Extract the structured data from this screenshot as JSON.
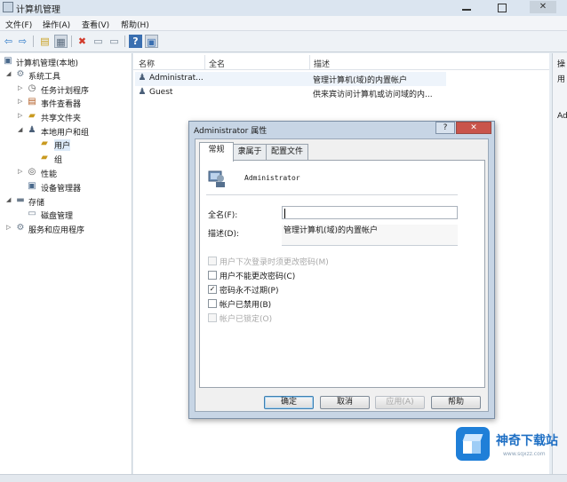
{
  "window": {
    "title": "计算机管理",
    "close_glyph": "✕"
  },
  "menu": [
    "文件(F)",
    "操作(A)",
    "查看(V)",
    "帮助(H)"
  ],
  "toolbar": {
    "icons": [
      "back-arrow-icon",
      "forward-arrow-icon",
      "up-folder-icon",
      "show-hide-tree-icon",
      "delete-icon",
      "properties-icon",
      "export-icon",
      "help-icon",
      "mmc-icon"
    ],
    "glyphs": {
      "back": "⇦",
      "forward": "⇨",
      "up": "▤",
      "tree": "▦",
      "delete": "✖",
      "props": "▭",
      "export": "▭",
      "help": "?",
      "mmc": "▣"
    }
  },
  "tree": {
    "root": "计算机管理(本地)",
    "system_tools": "系统工具",
    "task_scheduler": "任务计划程序",
    "event_viewer": "事件查看器",
    "shared_folders": "共享文件夹",
    "local_users_groups": "本地用户和组",
    "users": "用户",
    "groups": "组",
    "performance": "性能",
    "device_manager": "设备管理器",
    "storage": "存储",
    "disk_management": "磁盘管理",
    "services_apps": "服务和应用程序"
  },
  "list": {
    "columns": [
      "名称",
      "全名",
      "描述"
    ],
    "rows": [
      {
        "name": "Administrat...",
        "full_name": "",
        "description": "管理计算机(域)的内置帐户"
      },
      {
        "name": "Guest",
        "full_name": "",
        "description": "供来宾访问计算机或访问域的内..."
      }
    ]
  },
  "actions_pane": {
    "label_top": "操",
    "label_mid": "用",
    "label_low": "Ad"
  },
  "dialog": {
    "title": "Administrator 属性",
    "help_glyph": "?",
    "close_glyph": "✕",
    "tabs": [
      "常规",
      "隶属于",
      "配置文件"
    ],
    "active_tab": 0,
    "user_name": "Administrator",
    "full_name_label": "全名(F):",
    "full_name_value": "",
    "description_label": "描述(D):",
    "description_value": "管理计算机(域)的内置帐户",
    "checkboxes": [
      {
        "label": "用户下次登录时须更改密码(M)",
        "checked": false,
        "enabled": false
      },
      {
        "label": "用户不能更改密码(C)",
        "checked": false,
        "enabled": true
      },
      {
        "label": "密码永不过期(P)",
        "checked": true,
        "enabled": true
      },
      {
        "label": "帐户已禁用(B)",
        "checked": false,
        "enabled": true
      },
      {
        "label": "帐户已锁定(O)",
        "checked": false,
        "enabled": false
      }
    ],
    "buttons": {
      "ok": "确定",
      "cancel": "取消",
      "apply": "应用(A)",
      "help": "帮助"
    }
  },
  "watermark": {
    "name": "神奇下载站",
    "url": "www.sqxzz.com"
  }
}
